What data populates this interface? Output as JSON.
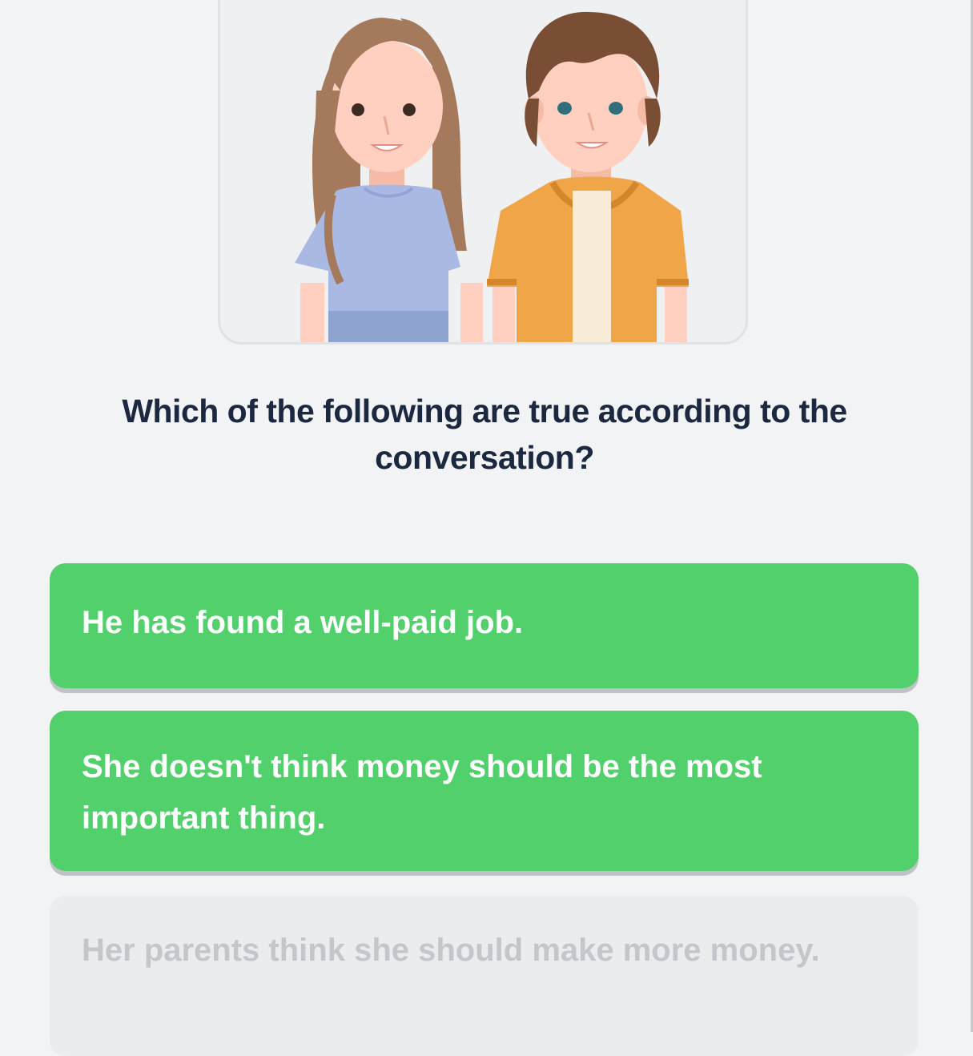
{
  "question": {
    "text": "Which of the following are true according to the conversation?"
  },
  "options": [
    {
      "text": "He has found a well-paid job.",
      "state": "selected"
    },
    {
      "text": "She doesn't think money should be the most important thing.",
      "state": "selected"
    },
    {
      "text": "Her parents think she should make more money.",
      "state": "disabled"
    }
  ],
  "colors": {
    "selected_option": "#52d06b",
    "disabled_option": "#ebecee",
    "question_text": "#1c2740",
    "page_background": "#f2f3f5"
  },
  "illustration": {
    "characters": [
      "woman-character",
      "man-character"
    ]
  }
}
